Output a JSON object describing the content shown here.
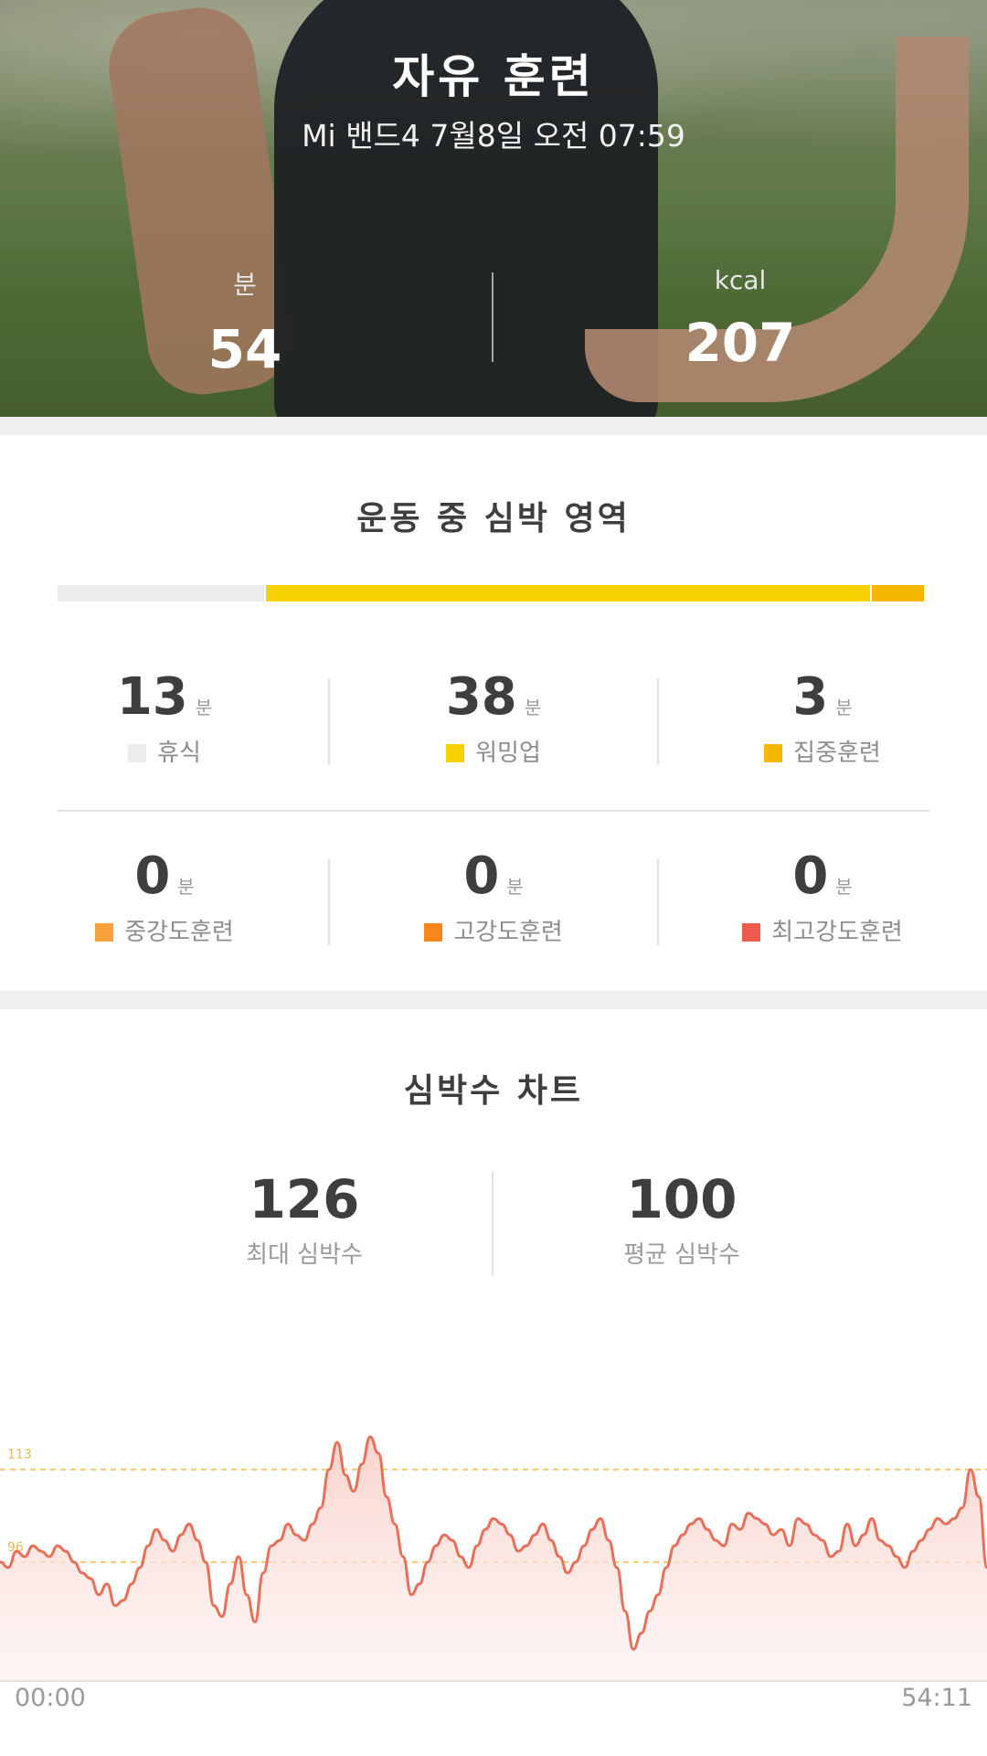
{
  "header": {
    "title": "자유 훈련",
    "subtitle": "Mi 밴드4 7월8일 오전 07:59",
    "stats": [
      {
        "label": "분",
        "value": "54"
      },
      {
        "label": "kcal",
        "value": "207"
      }
    ]
  },
  "zones_section": {
    "title": "운동 중 심박 영역",
    "bar": [
      {
        "name": "휴식",
        "fraction": 0.24,
        "color": "#ececec"
      },
      {
        "name": "워밍업",
        "fraction": 0.7,
        "color": "#f7d200"
      },
      {
        "name": "집중훈련",
        "fraction": 0.06,
        "color": "#f5b800"
      }
    ],
    "zones": [
      {
        "value": "13",
        "unit": "분",
        "label": "휴식",
        "color": "#ececec"
      },
      {
        "value": "38",
        "unit": "분",
        "label": "워밍업",
        "color": "#f7d200"
      },
      {
        "value": "3",
        "unit": "분",
        "label": "집중훈련",
        "color": "#f5b800"
      },
      {
        "value": "0",
        "unit": "분",
        "label": "중강도훈련",
        "color": "#f9a13a"
      },
      {
        "value": "0",
        "unit": "분",
        "label": "고강도훈련",
        "color": "#f7861c"
      },
      {
        "value": "0",
        "unit": "분",
        "label": "최고강도훈련",
        "color": "#f05a4e"
      }
    ]
  },
  "heart_section": {
    "title": "심박수 차트",
    "max_value": "126",
    "max_label": "최대 심박수",
    "avg_value": "100",
    "avg_label": "평균 심박수"
  },
  "chart_data": {
    "type": "area",
    "reference_lines": [
      {
        "label": "113",
        "value": 113
      },
      {
        "label": "96",
        "value": 96
      }
    ],
    "x_start_label": "00:00",
    "x_end_label": "54:11",
    "y_range": [
      75,
      122
    ],
    "values": [
      96,
      95,
      98,
      97,
      99,
      98,
      97,
      99,
      98,
      96,
      94,
      93,
      90,
      92,
      88,
      89,
      92,
      95,
      99,
      102,
      100,
      98,
      101,
      103,
      100,
      96,
      88,
      86,
      92,
      97,
      90,
      85,
      94,
      99,
      100,
      103,
      101,
      100,
      103,
      106,
      113,
      118,
      112,
      109,
      114,
      119,
      116,
      108,
      103,
      97,
      90,
      92,
      96,
      99,
      101,
      100,
      97,
      95,
      99,
      102,
      104,
      103,
      101,
      98,
      99,
      101,
      103,
      100,
      97,
      94,
      96,
      99,
      102,
      104,
      100,
      95,
      87,
      80,
      83,
      87,
      90,
      95,
      99,
      101,
      103,
      104,
      102,
      100,
      99,
      103,
      102,
      105,
      104,
      103,
      101,
      102,
      99,
      104,
      103,
      101,
      100,
      97,
      98,
      103,
      99,
      101,
      104,
      100,
      99,
      97,
      95,
      98,
      100,
      102,
      104,
      103,
      104,
      106,
      113,
      108,
      95
    ],
    "line_color": "#e8705a",
    "fill_color": "#fbe0dc"
  }
}
